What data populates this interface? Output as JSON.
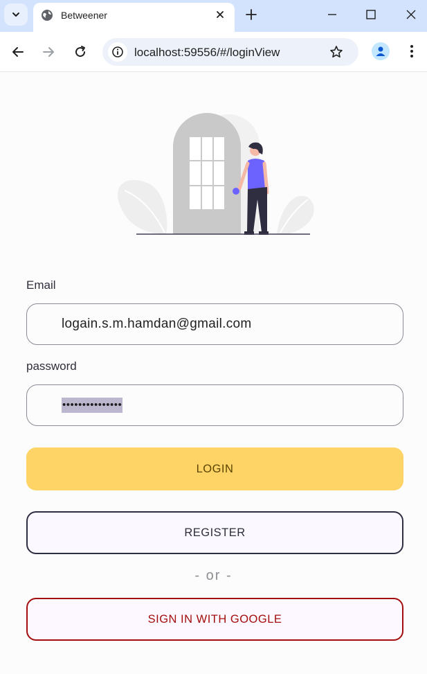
{
  "browser": {
    "tab_title": "Betweener",
    "url": "localhost:59556/#/loginView"
  },
  "form": {
    "email_label": "Email",
    "email_value": "logain.s.m.hamdan@gmail.com",
    "password_label": "password",
    "password_masked": "•••••••••••••••"
  },
  "buttons": {
    "login": "LOGIN",
    "register": "REGISTER",
    "or_separator": "- or -",
    "google": "SIGN IN WITH GOOGLE"
  },
  "colors": {
    "login_bg": "#ffd466",
    "register_border": "#2e2e42",
    "google_border": "#a30d0d",
    "figure_shirt": "#6c63ff"
  }
}
